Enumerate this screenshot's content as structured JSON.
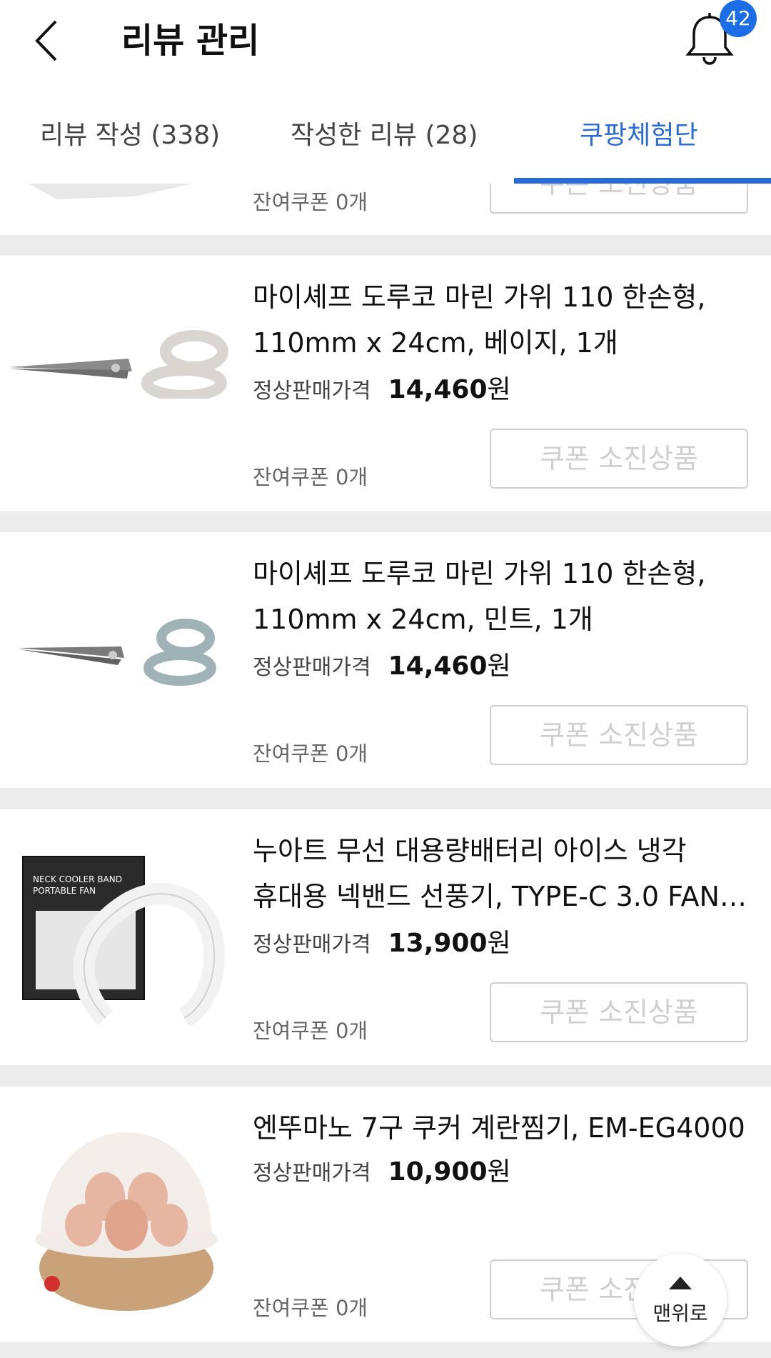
{
  "header": {
    "title": "리뷰 관리",
    "notification_count": "42"
  },
  "tabs": [
    {
      "label": "리뷰 작성 (338)"
    },
    {
      "label": "작성한 리뷰 (28)"
    },
    {
      "label": "쿠팡체험단",
      "active": true
    }
  ],
  "colors": {
    "accent": "#2a6ad9",
    "badge": "#1b6ee6"
  },
  "price_label": "정상판매가격",
  "top_partial_item": {
    "coupon_left": "잔여쿠폰 0개",
    "button_label": "쿠폰 소진상품"
  },
  "products": [
    {
      "name_lines": [
        "마이셰프 도루코 마린 가위 110 한손형,",
        "110mm x 24cm, 베이지, 1개"
      ],
      "price": "14,460",
      "currency": "원",
      "coupon_left": "잔여쿠폰 0개",
      "button_label": "쿠폰 소진상품",
      "image": "beige-scissors"
    },
    {
      "name_lines": [
        "마이셰프 도루코 마린 가위 110 한손형,",
        "110mm x 24cm, 민트, 1개"
      ],
      "price": "14,460",
      "currency": "원",
      "coupon_left": "잔여쿠폰 0개",
      "button_label": "쿠폰 소진상품",
      "image": "mint-scissors"
    },
    {
      "name_lines": [
        "누아트 무선 대용량배터리 아이스 냉각",
        "휴대용 넥밴드 선풍기, TYPE-C 3.0 FAN,..."
      ],
      "price": "13,900",
      "currency": "원",
      "coupon_left": "잔여쿠폰 0개",
      "button_label": "쿠폰 소진상품",
      "image": "neck-fan-with-box",
      "box_text": [
        "NECK COOLER BAND",
        "PORTABLE FAN"
      ]
    },
    {
      "name_lines": [
        "엔뚜마노 7구 쿠커 계란찜기, EM-EG4000"
      ],
      "price": "10,900",
      "currency": "원",
      "coupon_left": "잔여쿠폰 0개",
      "button_label": "쿠폰 소진상품",
      "image": "egg-cooker"
    }
  ],
  "scroll_top_button": {
    "label": "맨위로",
    "icon": "triangle-up-icon"
  }
}
